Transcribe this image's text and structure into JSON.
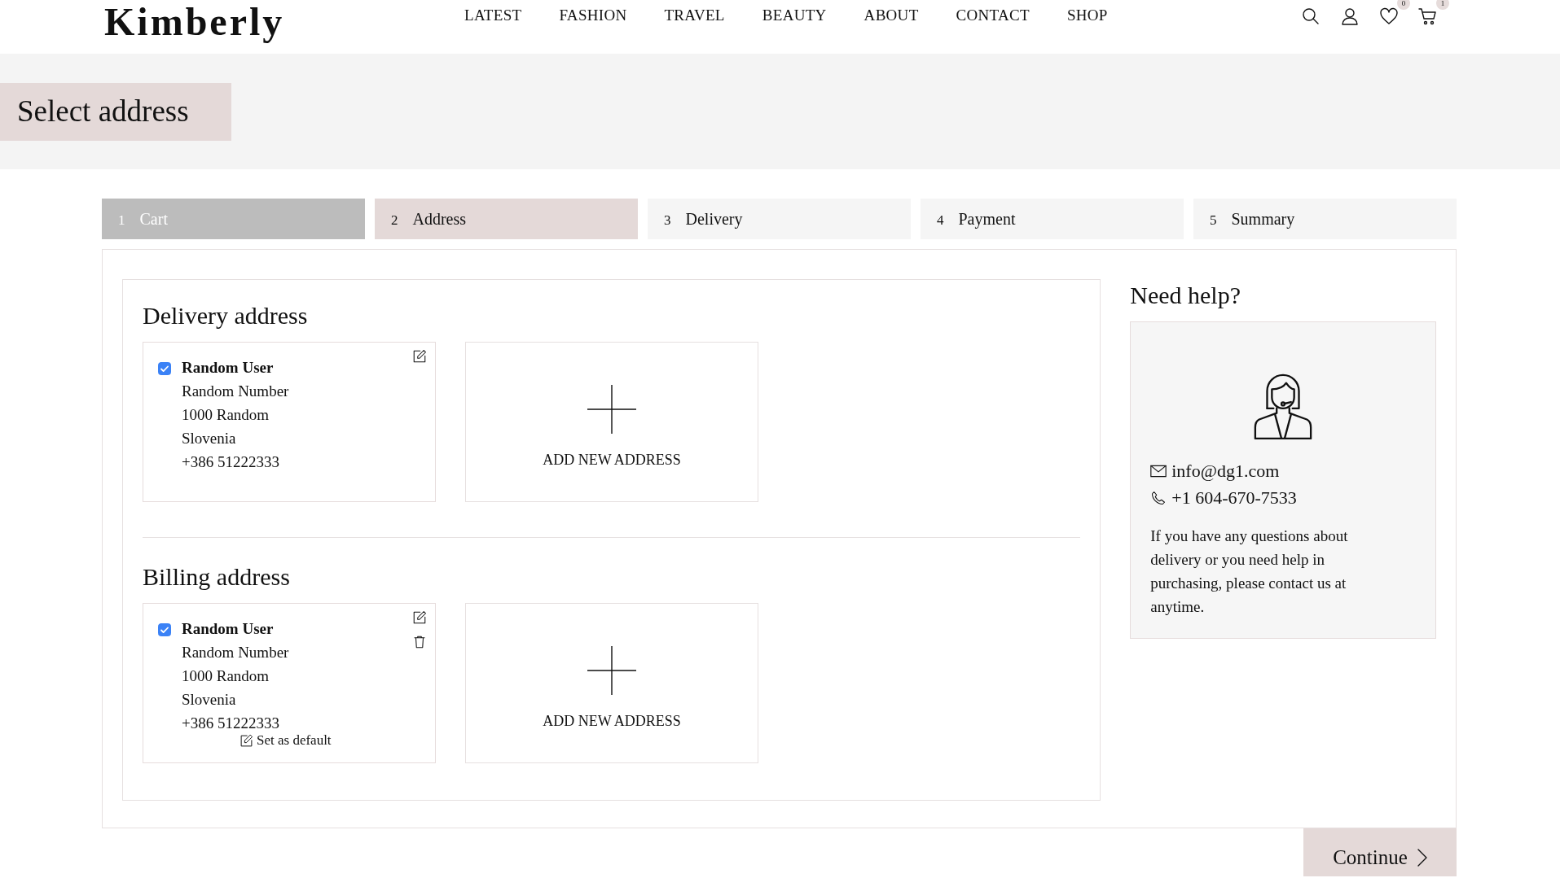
{
  "header": {
    "logo": "Kimberly",
    "nav": [
      {
        "label": "LATEST"
      },
      {
        "label": "FASHION"
      },
      {
        "label": "TRAVEL"
      },
      {
        "label": "BEAUTY"
      },
      {
        "label": "ABOUT"
      },
      {
        "label": "CONTACT"
      },
      {
        "label": "SHOP"
      }
    ],
    "icons": [
      {
        "kind": "search"
      },
      {
        "kind": "user"
      },
      {
        "kind": "heart",
        "badge": "0"
      },
      {
        "kind": "cart",
        "badge": "1"
      }
    ]
  },
  "page_title": "Select address",
  "steps": [
    {
      "number": "1",
      "label": "Cart",
      "completed": true,
      "selected": false
    },
    {
      "number": "2",
      "label": "Address",
      "completed": false,
      "selected": true
    },
    {
      "number": "3",
      "label": "Delivery",
      "completed": false,
      "selected": false
    },
    {
      "number": "4",
      "label": "Payment",
      "completed": false,
      "selected": false
    },
    {
      "number": "5",
      "label": "Summary",
      "completed": false,
      "selected": false
    }
  ],
  "sections": [
    {
      "title": "Delivery address",
      "addresses": [
        {
          "name": "Random User",
          "lines": [
            "Random Number",
            "1000 Random",
            "Slovenia",
            "+386  51222333"
          ],
          "checked": true,
          "deletable": false
        }
      ],
      "add_label": "ADD NEW ADDRESS"
    },
    {
      "title": "Billing address",
      "addresses": [
        {
          "name": "Random User",
          "lines": [
            "Random Number",
            "1000 Random",
            "Slovenia",
            "+386  51222333"
          ],
          "checked": true,
          "deletable": true,
          "default_link": "Set as default"
        }
      ],
      "add_label": "ADD NEW ADDRESS"
    }
  ],
  "help": {
    "title": "Need help?",
    "email": "info@dg1.com",
    "phone": "+1 604-670-7533",
    "text": "If you have any questions about delivery or you need help in purchasing, please contact us at anytime."
  },
  "continue_button": "Continue"
}
